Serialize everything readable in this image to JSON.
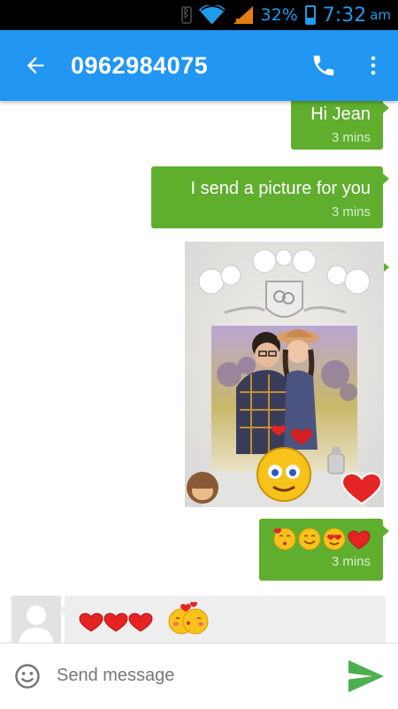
{
  "status_bar": {
    "battery": "32%",
    "battery_level": 0.32,
    "time": "7:32",
    "ampm": "am",
    "icons": [
      "bluetooth-icon",
      "wifi-icon",
      "signal-icon",
      "battery-icon"
    ],
    "color": "#1e9be9"
  },
  "app_bar": {
    "title": "0962984075",
    "back_icon": "arrow-back-icon",
    "call_icon": "phone-icon",
    "more_icon": "more-vert-icon",
    "color": "#2196f3"
  },
  "messages": [
    {
      "direction": "out",
      "type": "text",
      "text": "Hi Jean",
      "time": "3 mins"
    },
    {
      "direction": "out",
      "type": "text",
      "text": "I send a picture for you",
      "time": "3 mins"
    },
    {
      "direction": "out",
      "type": "image",
      "content": "wedding-photo-with-emoji-stickers"
    },
    {
      "direction": "out",
      "type": "emoji",
      "emojis": [
        "kissing-face-icon",
        "smiling-face-icon",
        "heart-eyes-face-icon",
        "red-heart-icon"
      ],
      "time": "3 mins"
    },
    {
      "direction": "in",
      "type": "emoji",
      "emojis": [
        "red-heart-icon",
        "red-heart-icon",
        "red-heart-icon",
        "kissing-couple-icon"
      ]
    }
  ],
  "composer": {
    "placeholder": "Send message",
    "emoji_icon": "smiley-icon",
    "send_icon": "send-icon"
  },
  "colors": {
    "outgoing_bubble": "#5fae2e",
    "incoming_bubble": "#eeeeee",
    "send_button": "#4caf50"
  }
}
